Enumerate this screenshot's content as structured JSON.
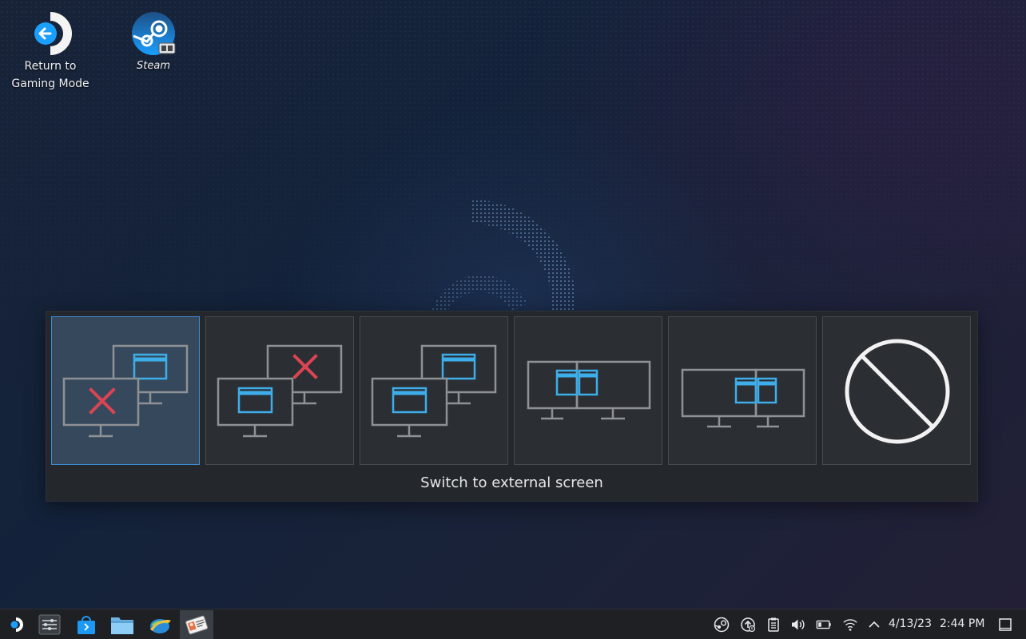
{
  "desktop": {
    "icons": [
      {
        "label_line1": "Return to",
        "label_line2": "Gaming Mode",
        "icon": "return-to-gaming-mode-icon"
      },
      {
        "label": "Steam",
        "icon": "steam-icon"
      }
    ]
  },
  "display_switcher": {
    "caption": "Switch to external screen",
    "selected_index": 0,
    "options": [
      {
        "icon": "laptop-screen-only-icon"
      },
      {
        "icon": "external-screen-only-icon"
      },
      {
        "icon": "mirror-screens-icon"
      },
      {
        "icon": "extend-left-icon"
      },
      {
        "icon": "extend-right-icon"
      },
      {
        "icon": "no-change-icon"
      }
    ]
  },
  "taskbar": {
    "launcher_icon": "steam-deck-launcher-icon",
    "apps": [
      {
        "icon": "system-settings-icon"
      },
      {
        "icon": "discover-store-icon"
      },
      {
        "icon": "file-manager-icon"
      },
      {
        "icon": "browser-icon"
      },
      {
        "icon": "identity-card-app-icon",
        "active": true
      }
    ],
    "tray_icons": [
      "steam-tray-icon",
      "updates-icon",
      "clipboard-icon",
      "volume-icon",
      "battery-icon",
      "wifi-icon",
      "show-hidden-tray-icon"
    ],
    "date": "4/13/23",
    "time": "2:44 PM",
    "show_desktop_icon": "show-desktop-icon"
  },
  "colors": {
    "accent": "#3daee9",
    "disable_red": "#da4453",
    "selected_bg": "#36495c",
    "monitor_gray": "#8e9195"
  }
}
